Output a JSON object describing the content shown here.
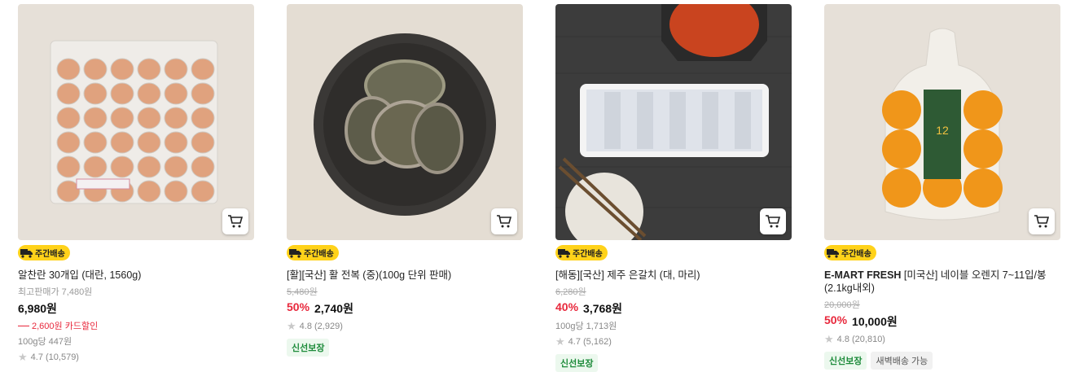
{
  "products": [
    {
      "badge": "주간배송",
      "title_bold": "",
      "title": "알찬란 30개입 (대란, 1560g)",
      "sub_label": "최고판매가 7,480원",
      "price": "6,980원",
      "card_discount": "2,600원 카드할인",
      "unit_price": "100g당 447원",
      "rating": "4.7 (10,579)"
    },
    {
      "badge": "주간배송",
      "title_bold": "",
      "title": "[활][국산] 활 전복 (중)(100g 단위 판매)",
      "original_price": "5,480원",
      "discount": "50%",
      "price": "2,740원",
      "rating": "4.8 (2,929)",
      "tags": [
        "신선보장"
      ]
    },
    {
      "badge": "주간배송",
      "title_bold": "",
      "title": "[해동][국산] 제주 은갈치 (대, 마리)",
      "original_price": "6,280원",
      "discount": "40%",
      "price": "3,768원",
      "unit_price": "100g당 1,713원",
      "rating": "4.7 (5,162)",
      "tags": [
        "신선보장"
      ]
    },
    {
      "badge": "주간배송",
      "title_bold": "E-MART FRESH",
      "title": " [미국산] 네이블 오렌지 7~11입/봉 (2.1kg내외)",
      "original_price": "20,000원",
      "discount": "50%",
      "price": "10,000원",
      "rating": "4.8 (20,810)",
      "tags": [
        "신선보장",
        "새벽배송 가능"
      ]
    }
  ],
  "icons": {
    "cart": "cart-icon",
    "star": "star-icon",
    "delivery": "truck-icon"
  },
  "colors": {
    "badge": "#ffd21a",
    "discount": "#e8283c",
    "fresh_tag": "#1d8b3a"
  }
}
